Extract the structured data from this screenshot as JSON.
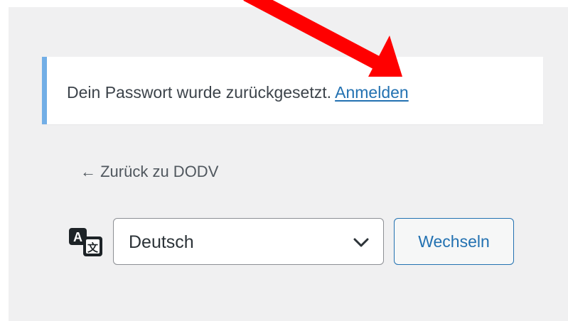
{
  "notice": {
    "message": "Dein Passwort wurde zurückgesetzt.",
    "link_label": "Anmelden"
  },
  "back_link": {
    "label": "← Zurück zu DODV"
  },
  "language": {
    "icon": "translation-icon",
    "selected": "Deutsch",
    "switch_label": "Wechseln"
  },
  "colors": {
    "background": "#f0f0f1",
    "notice_border": "#72aee6",
    "link": "#2271b1",
    "annotation_arrow": "#ff0000"
  }
}
